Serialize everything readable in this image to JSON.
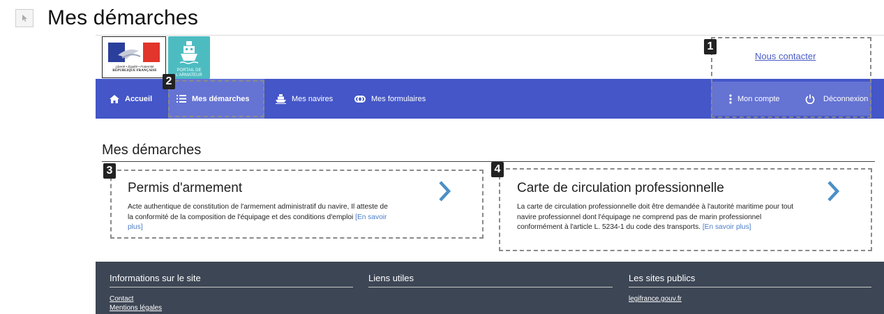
{
  "doc": {
    "title": "Mes démarches"
  },
  "header": {
    "marianne_motto": "Liberté • Égalité • Fraternité",
    "marianne_republic": "RÉPUBLIQUE FRANÇAISE",
    "portail_line1": "PORTAIL DE",
    "portail_line2": "L'ARMATEUR",
    "contact_label": "Nous contacter"
  },
  "nav": {
    "home": "Accueil",
    "demarches": "Mes démarches",
    "navires": "Mes navires",
    "formulaires": "Mes formulaires",
    "account": "Mon compte",
    "logout": "Déconnexion"
  },
  "annotations": {
    "b1": "1",
    "b2": "2",
    "b3": "3",
    "b4": "4"
  },
  "main": {
    "title": "Mes démarches",
    "cards": [
      {
        "title": "Permis d'armement",
        "desc": "Acte authentique de constitution de l'armement administratif du navire, Il atteste de la conformité de la composition de l'équipage et des conditions d'emploi",
        "more": "[En savoir plus]"
      },
      {
        "title": "Carte de circulation professionnelle",
        "desc": "La carte de circulation professionnelle doit être demandée à l'autorité maritime pour tout navire professionnel dont l'équipage ne comprend pas de marin professionnel conformément à l'article L. 5234-1 du code des transports.",
        "more": "[En savoir plus]"
      }
    ]
  },
  "footer": {
    "col1_title": "Informations sur le site",
    "col1_links": [
      "Contact",
      "Mentions légales"
    ],
    "col2_title": "Liens utiles",
    "col3_title": "Les sites publics",
    "col3_links": [
      "legifrance.gouv.fr"
    ]
  },
  "colors": {
    "nav": "#4456c8",
    "nav_active": "#6573d3",
    "footer": "#3d4655",
    "link": "#4a7cc8",
    "teal": "#4dbcc1"
  }
}
